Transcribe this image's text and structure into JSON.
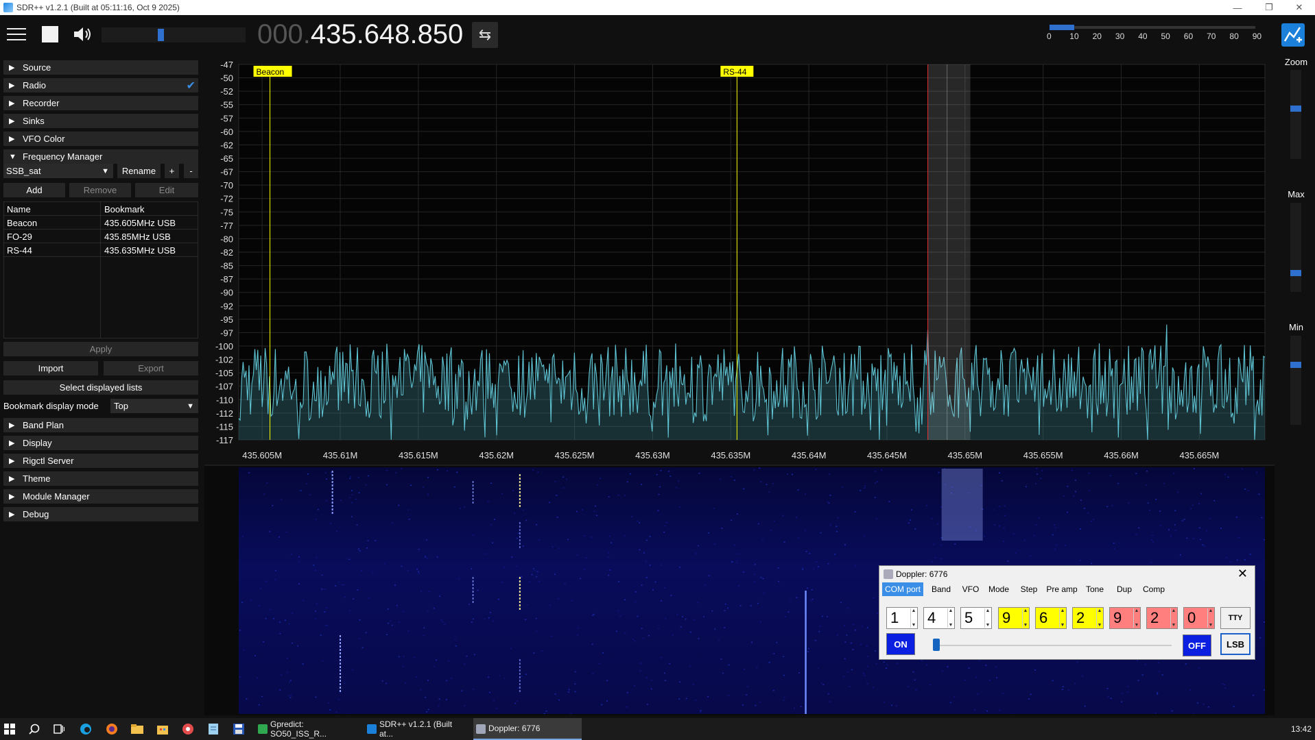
{
  "window": {
    "title": "SDR++ v1.2.1 (Built at 05:11:16, Oct  9 2025)",
    "minimize": "—",
    "maximize": "❐",
    "close": "✕"
  },
  "toolbar": {
    "freq_prefix": "000.",
    "freq_main": "435.648.850",
    "swap_icon": "⇆",
    "snr_ticks": [
      "0",
      "10",
      "20",
      "30",
      "40",
      "50",
      "60",
      "70",
      "80",
      "90"
    ]
  },
  "sidebar": {
    "menus_top": [
      {
        "label": "Source",
        "open": false
      },
      {
        "label": "Radio",
        "open": false,
        "checked": true
      },
      {
        "label": "Recorder",
        "open": false
      },
      {
        "label": "Sinks",
        "open": false
      },
      {
        "label": "VFO Color",
        "open": false
      },
      {
        "label": "Frequency Manager",
        "open": true
      }
    ],
    "freq_manager": {
      "list_select": "SSB_sat",
      "rename": "Rename",
      "plus": "+",
      "minus": "-",
      "add": "Add",
      "remove": "Remove",
      "edit": "Edit",
      "table_headers": [
        "Name",
        "Bookmark"
      ],
      "bookmarks": [
        {
          "name": "Beacon",
          "value": "435.605MHz USB"
        },
        {
          "name": "FO-29",
          "value": "435.85MHz USB"
        },
        {
          "name": "RS-44",
          "value": "435.635MHz USB"
        }
      ],
      "apply": "Apply",
      "import": "Import",
      "export": "Export",
      "select_lists": "Select displayed lists",
      "display_mode_label": "Bookmark display mode",
      "display_mode_value": "Top"
    },
    "menus_bottom": [
      {
        "label": "Band Plan"
      },
      {
        "label": "Display"
      },
      {
        "label": "Rigctl Server"
      },
      {
        "label": "Theme"
      },
      {
        "label": "Module Manager"
      },
      {
        "label": "Debug"
      }
    ]
  },
  "spectrum": {
    "y_labels": [
      "-47",
      "-50",
      "-52",
      "-55",
      "-57",
      "-60",
      "-62",
      "-65",
      "-67",
      "-70",
      "-72",
      "-75",
      "-77",
      "-80",
      "-82",
      "-85",
      "-87",
      "-90",
      "-92",
      "-95",
      "-97",
      "-100",
      "-102",
      "-105",
      "-107",
      "-110",
      "-112",
      "-115",
      "-117"
    ],
    "x_labels": [
      "435.605M",
      "435.61M",
      "435.615M",
      "435.62M",
      "435.625M",
      "435.63M",
      "435.635M",
      "435.64M",
      "435.645M",
      "435.65M",
      "435.655M",
      "435.66M",
      "435.665M"
    ],
    "markers": [
      {
        "label": "Beacon",
        "freq": 435.6055
      },
      {
        "label": "RS-44",
        "freq": 435.6354
      }
    ],
    "vfo_freq": 435.64885,
    "trace_color": "#5fc4d4",
    "marker_color": "#ffff00"
  },
  "right_panel": {
    "zoom_label": "Zoom",
    "max_label": "Max",
    "min_label": "Min"
  },
  "doppler": {
    "title": "Doppler: 6776",
    "tabs": [
      "COM port",
      "Band",
      "VFO",
      "Mode",
      "Step",
      "Pre amp",
      "Tone",
      "Dup",
      "Comp"
    ],
    "digits": [
      {
        "d": "1",
        "bg": "#ffffff"
      },
      {
        "d": "4",
        "bg": "#ffffff"
      },
      {
        "d": "5",
        "bg": "#ffffff"
      },
      {
        "d": "9",
        "bg": "#ffff00"
      },
      {
        "d": "6",
        "bg": "#ffff00"
      },
      {
        "d": "2",
        "bg": "#ffff00"
      },
      {
        "d": "9",
        "bg": "#ff7f7f"
      },
      {
        "d": "2",
        "bg": "#ff7f7f"
      },
      {
        "d": "0",
        "bg": "#ff7f7f"
      }
    ],
    "tty": "TTY",
    "on": "ON",
    "off": "OFF",
    "lsb": "LSB"
  },
  "taskbar": {
    "tasks": [
      {
        "label": "Gpredict: SO50_ISS_R...",
        "color": "#2fa84f"
      },
      {
        "label": "SDR++ v1.2.1 (Built at...",
        "color": "#1a80d9"
      },
      {
        "label": "Doppler: 6776",
        "color": "#a0a6b8"
      }
    ],
    "clock": "13:42"
  }
}
